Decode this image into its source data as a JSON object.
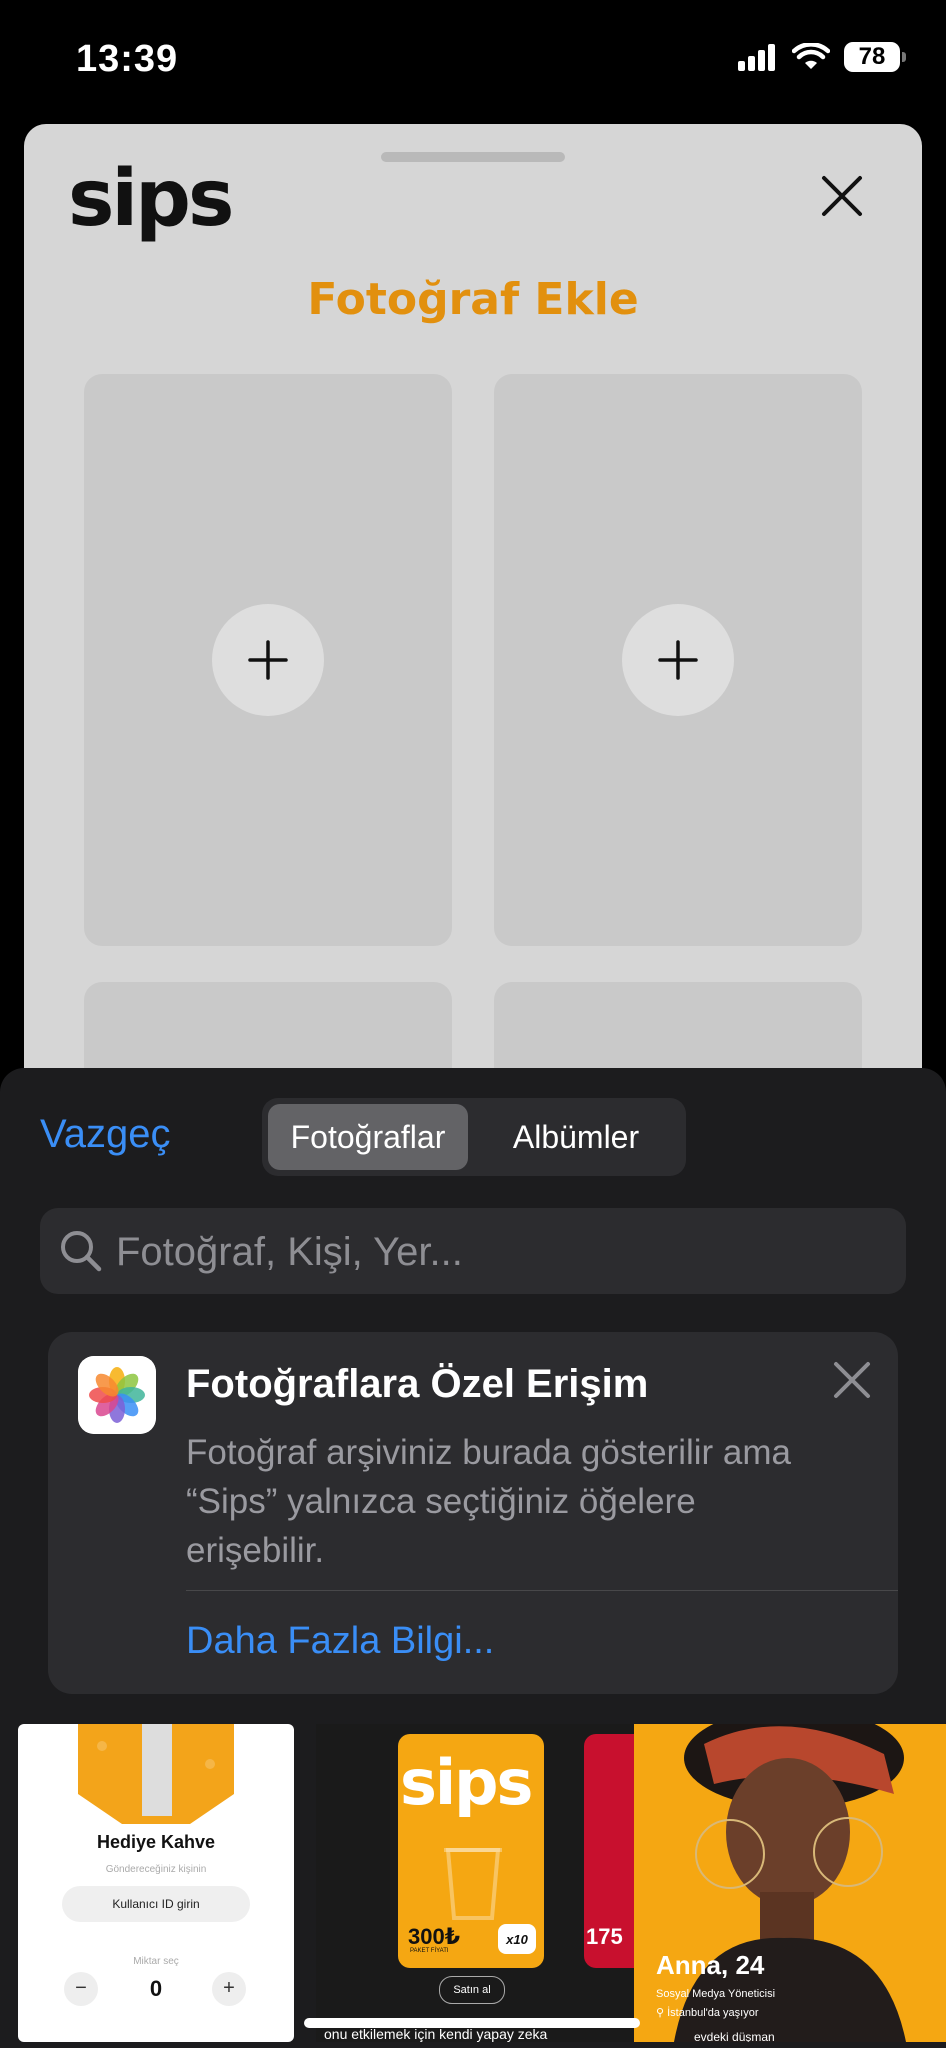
{
  "status": {
    "time": "13:39",
    "battery": "78"
  },
  "sheet": {
    "logo": "sips",
    "title": "Fotoğraf Ekle"
  },
  "picker": {
    "cancel": "Vazgeç",
    "tabs": [
      {
        "label": "Fotoğraflar",
        "active": true
      },
      {
        "label": "Albümler",
        "active": false
      }
    ],
    "search_placeholder": "Fotoğraf, Kişi, Yer...",
    "notice": {
      "title": "Fotoğraflara Özel Erişim",
      "body": "Fotoğraf arşiviniz burada gösterilir ama “Sips” yalnızca seçtiğiniz öğelere erişebilir.",
      "link": "Daha Fazla Bilgi..."
    }
  },
  "thumbs": {
    "gift": {
      "title": "Hediye Kahve",
      "subtitle": "Göndereceğiniz kişinin",
      "input": "Kullanıcı ID girin",
      "qty_label": "Miktar seç",
      "qty": "0"
    },
    "packs": {
      "logo": "sips",
      "price": "300₺",
      "price_label": "PAKET FİYATI",
      "count": "x10",
      "price2": "175",
      "buy": "Satın al",
      "caption": "onu etkilemek için kendi yapay zeka"
    },
    "profile": {
      "name": "Anna, 24",
      "role": "Sosyal Medya Yöneticisi",
      "location": "İstanbul'da yaşıyor",
      "caption": "evdeki düşman"
    }
  },
  "colors": {
    "accent_orange": "#e2900e",
    "ios_blue": "#3a8ef6"
  }
}
